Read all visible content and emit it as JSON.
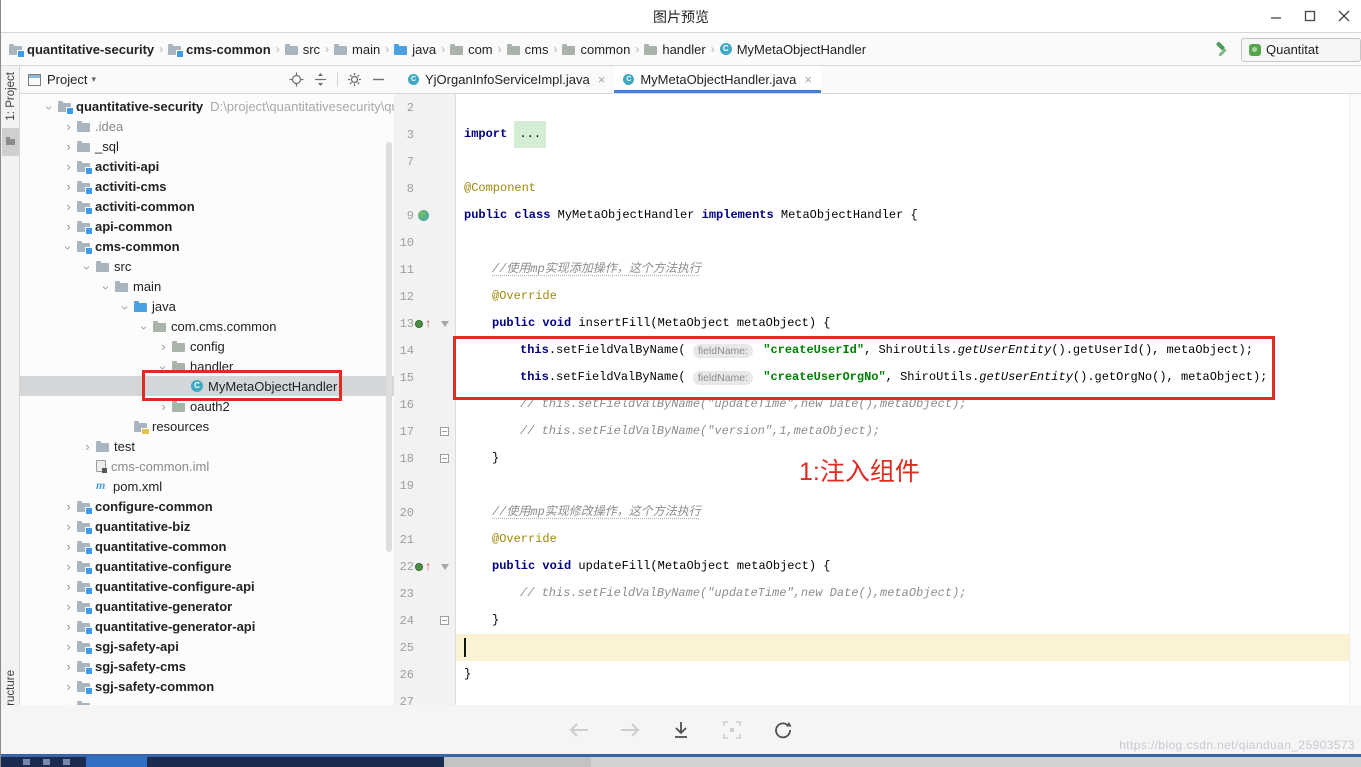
{
  "window": {
    "title": "图片预览",
    "controls": [
      "minimize",
      "maximize",
      "close"
    ]
  },
  "breadcrumbs": {
    "items": [
      {
        "label": "quantitative-security",
        "icon": "module",
        "bold": true
      },
      {
        "label": "cms-common",
        "icon": "module",
        "bold": true
      },
      {
        "label": "src",
        "icon": "folder"
      },
      {
        "label": "main",
        "icon": "folder"
      },
      {
        "label": "java",
        "icon": "source-folder"
      },
      {
        "label": "com",
        "icon": "package"
      },
      {
        "label": "cms",
        "icon": "package"
      },
      {
        "label": "common",
        "icon": "package"
      },
      {
        "label": "handler",
        "icon": "package"
      },
      {
        "label": "MyMetaObjectHandler",
        "icon": "class"
      }
    ],
    "run_config": "Quantitat"
  },
  "tool_strip": {
    "top_label": "1: Project",
    "bottom_label": "tructure"
  },
  "project_panel": {
    "title": "Project",
    "header_icons": [
      "locate-icon",
      "collapse-all-icon",
      "settings-gear-icon",
      "hide-panel-icon"
    ],
    "tree": [
      {
        "label": "quantitative-security",
        "level": 0,
        "state": "expanded",
        "icon": "module",
        "bold": true,
        "suffix": "D:\\project\\quantitativesecurity\\qua"
      },
      {
        "label": ".idea",
        "level": 1,
        "state": "collapsed",
        "icon": "folder",
        "muted": true
      },
      {
        "label": "_sql",
        "level": 1,
        "state": "collapsed",
        "icon": "folder"
      },
      {
        "label": "activiti-api",
        "level": 1,
        "state": "collapsed",
        "icon": "module",
        "bold": true
      },
      {
        "label": "activiti-cms",
        "level": 1,
        "state": "collapsed",
        "icon": "module",
        "bold": true
      },
      {
        "label": "activiti-common",
        "level": 1,
        "state": "collapsed",
        "icon": "module",
        "bold": true
      },
      {
        "label": "api-common",
        "level": 1,
        "state": "collapsed",
        "icon": "module",
        "bold": true
      },
      {
        "label": "cms-common",
        "level": 1,
        "state": "expanded",
        "icon": "module",
        "bold": true
      },
      {
        "label": "src",
        "level": 2,
        "state": "expanded",
        "icon": "folder"
      },
      {
        "label": "main",
        "level": 3,
        "state": "expanded",
        "icon": "folder"
      },
      {
        "label": "java",
        "level": 4,
        "state": "expanded",
        "icon": "source-folder"
      },
      {
        "label": "com.cms.common",
        "level": 5,
        "state": "expanded",
        "icon": "package"
      },
      {
        "label": "config",
        "level": 6,
        "state": "collapsed",
        "icon": "package"
      },
      {
        "label": "handler",
        "level": 6,
        "state": "expanded",
        "icon": "package"
      },
      {
        "label": "MyMetaObjectHandler",
        "level": 7,
        "state": "none",
        "icon": "class",
        "selected": true
      },
      {
        "label": "oauth2",
        "level": 6,
        "state": "collapsed",
        "icon": "package"
      },
      {
        "label": "resources",
        "level": 4,
        "state": "none",
        "icon": "resources"
      },
      {
        "label": "test",
        "level": 2,
        "state": "collapsed",
        "icon": "folder"
      },
      {
        "label": "cms-common.iml",
        "level": 2,
        "state": "none",
        "icon": "iml",
        "muted": true
      },
      {
        "label": "pom.xml",
        "level": 2,
        "state": "none",
        "icon": "maven"
      },
      {
        "label": "configure-common",
        "level": 1,
        "state": "collapsed",
        "icon": "module",
        "bold": true
      },
      {
        "label": "quantitative-biz",
        "level": 1,
        "state": "collapsed",
        "icon": "module",
        "bold": true
      },
      {
        "label": "quantitative-common",
        "level": 1,
        "state": "collapsed",
        "icon": "module",
        "bold": true
      },
      {
        "label": "quantitative-configure",
        "level": 1,
        "state": "collapsed",
        "icon": "module",
        "bold": true
      },
      {
        "label": "quantitative-configure-api",
        "level": 1,
        "state": "collapsed",
        "icon": "module",
        "bold": true
      },
      {
        "label": "quantitative-generator",
        "level": 1,
        "state": "collapsed",
        "icon": "module",
        "bold": true
      },
      {
        "label": "quantitative-generator-api",
        "level": 1,
        "state": "collapsed",
        "icon": "module",
        "bold": true
      },
      {
        "label": "sgj-safety-api",
        "level": 1,
        "state": "collapsed",
        "icon": "module",
        "bold": true
      },
      {
        "label": "sgj-safety-cms",
        "level": 1,
        "state": "collapsed",
        "icon": "module",
        "bold": true
      },
      {
        "label": "sgj-safety-common",
        "level": 1,
        "state": "collapsed",
        "icon": "module",
        "bold": true
      },
      {
        "label": "",
        "level": 1,
        "state": "collapsed",
        "icon": "module",
        "bold": true
      }
    ]
  },
  "editor": {
    "tabs": [
      {
        "label": "YjOrganInfoServiceImpl.java",
        "active": false
      },
      {
        "label": "MyMetaObjectHandler.java",
        "active": true
      }
    ],
    "code_lines": [
      {
        "num": 2,
        "indent": 0,
        "tokens": []
      },
      {
        "num": 3,
        "indent": 0,
        "tokens": [
          {
            "t": "import ",
            "c": "kw"
          },
          {
            "t": "...",
            "c": "fold"
          }
        ]
      },
      {
        "num": 7,
        "indent": 0,
        "tokens": []
      },
      {
        "num": 8,
        "indent": 0,
        "tokens": [
          {
            "t": "@Component",
            "c": "ann"
          }
        ]
      },
      {
        "num": 9,
        "indent": 0,
        "gutter": "class",
        "tokens": [
          {
            "t": "public class ",
            "c": "kw"
          },
          {
            "t": "MyMetaObjectHandler ",
            "c": "plain"
          },
          {
            "t": "implements ",
            "c": "kw"
          },
          {
            "t": "MetaObjectHandler {",
            "c": "plain"
          }
        ]
      },
      {
        "num": 10,
        "indent": 0,
        "tokens": []
      },
      {
        "num": 11,
        "indent": 1,
        "tokens": [
          {
            "t": "//使用mp实现添加操作，这个方法执行",
            "c": "cmtu"
          }
        ]
      },
      {
        "num": 12,
        "indent": 1,
        "tokens": [
          {
            "t": "@Override",
            "c": "ann"
          }
        ]
      },
      {
        "num": 13,
        "indent": 1,
        "gutter": "override",
        "fold": "open",
        "tokens": [
          {
            "t": "public void ",
            "c": "kw"
          },
          {
            "t": "insertFill(MetaObject metaObject) {",
            "c": "plain"
          }
        ]
      },
      {
        "num": 14,
        "indent": 2,
        "tokens": [
          {
            "t": "this",
            "c": "kw"
          },
          {
            "t": ".setFieldValByName( ",
            "c": "plain"
          },
          {
            "t": "fieldName:",
            "c": "hint"
          },
          {
            "t": " ",
            "c": "plain"
          },
          {
            "t": "\"createUserId\"",
            "c": "str"
          },
          {
            "t": ", ShiroUtils.",
            "c": "plain"
          },
          {
            "t": "getUserEntity",
            "c": "static"
          },
          {
            "t": "().getUserId(), metaObject);",
            "c": "plain"
          }
        ]
      },
      {
        "num": 15,
        "indent": 2,
        "tokens": [
          {
            "t": "this",
            "c": "kw"
          },
          {
            "t": ".setFieldValByName( ",
            "c": "plain"
          },
          {
            "t": "fieldName:",
            "c": "hint"
          },
          {
            "t": " ",
            "c": "plain"
          },
          {
            "t": "\"createUserOrgNo\"",
            "c": "str"
          },
          {
            "t": ", ShiroUtils.",
            "c": "plain"
          },
          {
            "t": "getUserEntity",
            "c": "static"
          },
          {
            "t": "().getOrgNo(), metaObject);",
            "c": "plain"
          }
        ]
      },
      {
        "num": 16,
        "indent": 2,
        "tokens": [
          {
            "t": "// this.setFieldValByName(\"updateTime\",new Date(),metaObject);",
            "c": "cmt"
          }
        ]
      },
      {
        "num": 17,
        "indent": 2,
        "fold": "box",
        "tokens": [
          {
            "t": "// this.setFieldValByName(\"version\",1,metaObject);",
            "c": "cmt"
          }
        ]
      },
      {
        "num": 18,
        "indent": 1,
        "fold": "box",
        "tokens": [
          {
            "t": "}",
            "c": "plain"
          }
        ]
      },
      {
        "num": 19,
        "indent": 0,
        "tokens": []
      },
      {
        "num": 20,
        "indent": 1,
        "tokens": [
          {
            "t": "//使用mp实现修改操作，这个方法执行",
            "c": "cmtu"
          }
        ]
      },
      {
        "num": 21,
        "indent": 1,
        "tokens": [
          {
            "t": "@Override",
            "c": "ann"
          }
        ]
      },
      {
        "num": 22,
        "indent": 1,
        "gutter": "override",
        "fold": "open",
        "tokens": [
          {
            "t": "public void ",
            "c": "kw"
          },
          {
            "t": "updateFill(MetaObject metaObject) {",
            "c": "plain"
          }
        ]
      },
      {
        "num": 23,
        "indent": 2,
        "tokens": [
          {
            "t": "// this.setFieldValByName(\"updateTime\",new Date(),metaObject);",
            "c": "cmt"
          }
        ]
      },
      {
        "num": 24,
        "indent": 1,
        "fold": "box",
        "tokens": [
          {
            "t": "}",
            "c": "plain"
          }
        ]
      },
      {
        "num": 25,
        "indent": 0,
        "caret": true,
        "tokens": []
      },
      {
        "num": 26,
        "indent": 0,
        "tokens": [
          {
            "t": "}",
            "c": "plain"
          }
        ]
      },
      {
        "num": 27,
        "indent": 0,
        "tokens": []
      }
    ]
  },
  "annotations": {
    "callout": "1:注入组件"
  },
  "preview_toolbar": {
    "icons": [
      {
        "name": "back",
        "enabled": false
      },
      {
        "name": "forward",
        "enabled": false
      },
      {
        "name": "download",
        "enabled": true
      },
      {
        "name": "actual-size",
        "enabled": false
      },
      {
        "name": "rotate",
        "enabled": true
      }
    ]
  },
  "watermark": {
    "text": "https://blog.csdn.net/qianduan_25903573"
  },
  "colors": {
    "annotation_red": "#e02b20",
    "active_tab_underline": "#4083c9",
    "keyword": "#000080",
    "string": "#008000",
    "comment": "#8c8c8c",
    "annotation_token": "#9e880d",
    "caret_line": "#fbf2d3",
    "tree_selection": "#d4d7da",
    "taskbar_blue": "#2f6fc4"
  }
}
